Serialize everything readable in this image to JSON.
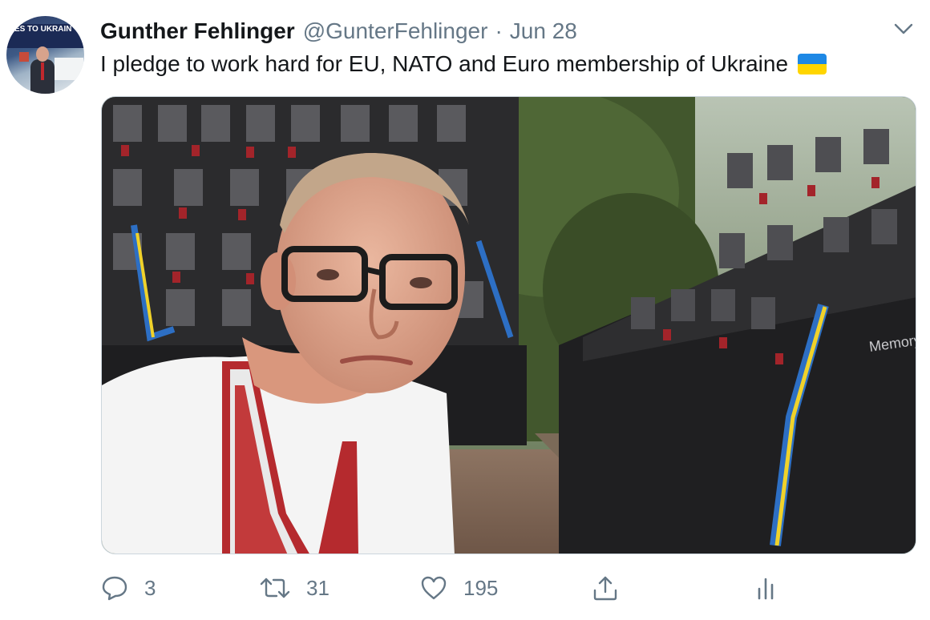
{
  "tweet": {
    "display_name": "Gunther Fehlinger",
    "handle": "@GunterFehlinger",
    "separator": "·",
    "date": "Jun 28",
    "text": "I pledge to work hard for EU, NATO and Euro membership of Ukraine",
    "emoji": "ukraine-flag"
  },
  "avatar": {
    "banner_text": "ES TO UKRAIN"
  },
  "photo": {
    "sign_text": "Memory"
  },
  "actions": {
    "reply_count": "3",
    "retweet_count": "31",
    "like_count": "195"
  },
  "colors": {
    "text_primary": "#14171a",
    "text_secondary": "#657786",
    "flag_blue": "#1e88e5",
    "flag_yellow": "#ffd500"
  }
}
